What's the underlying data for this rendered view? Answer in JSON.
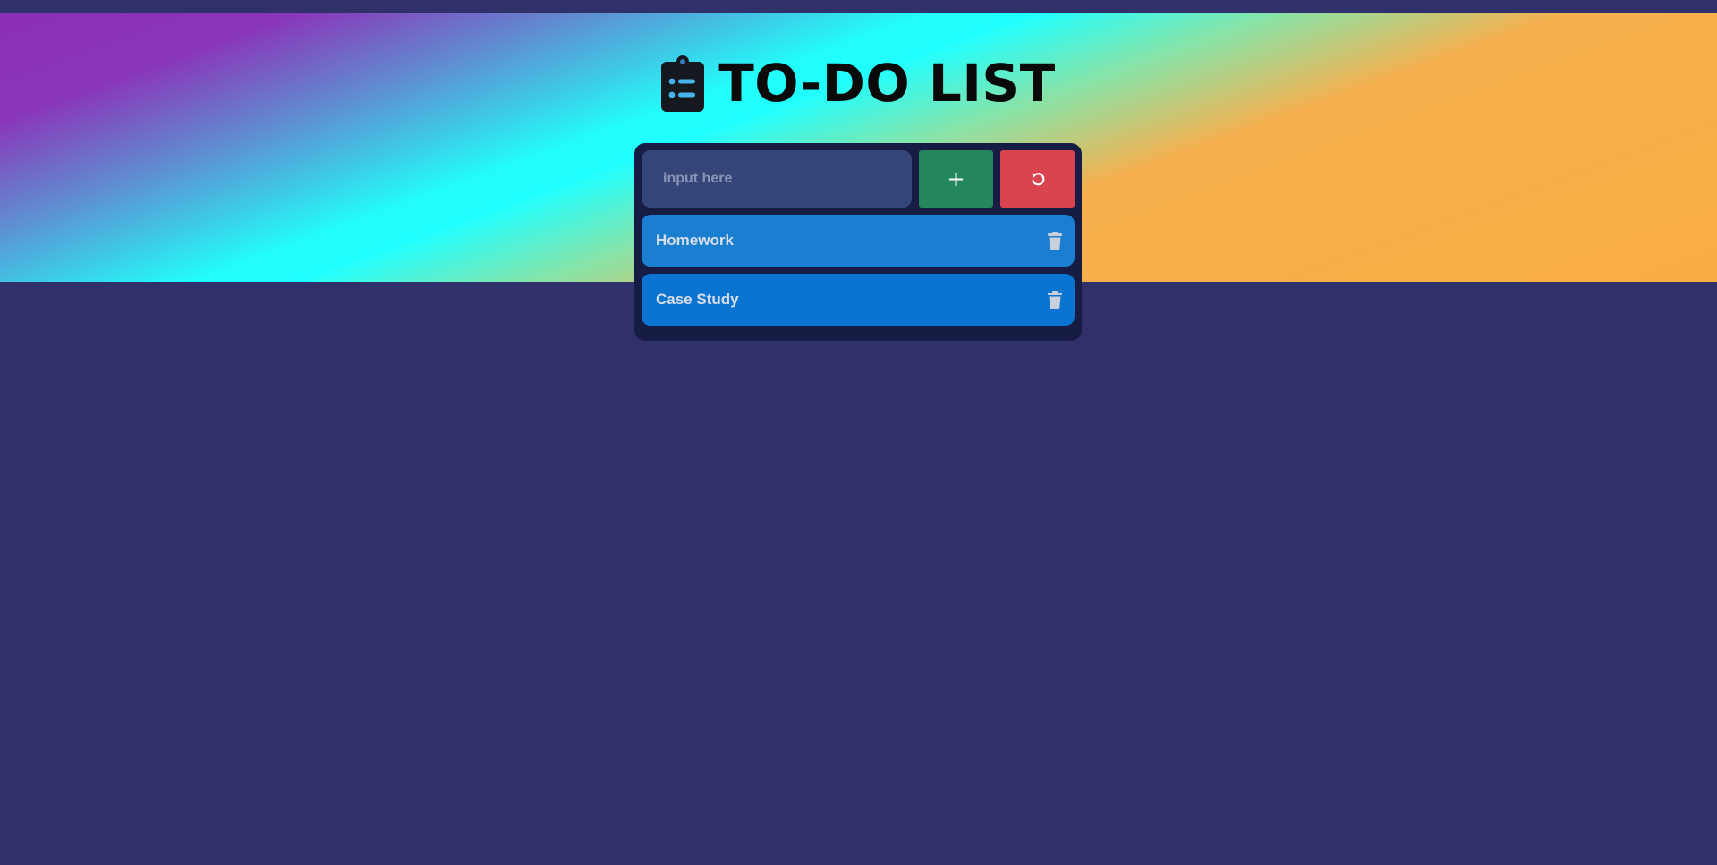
{
  "header": {
    "title": "TO-DO LIST",
    "icon": "clipboard-list-icon"
  },
  "input": {
    "placeholder": "input here",
    "value": ""
  },
  "buttons": {
    "add": {
      "label": "+",
      "icon": "plus-icon",
      "color": "#24875c"
    },
    "reset": {
      "icon": "rotate-left-icon",
      "color": "#d9444e"
    }
  },
  "todos": [
    {
      "label": "Homework",
      "icon": "trash-icon"
    },
    {
      "label": "Case Study",
      "icon": "trash-icon"
    }
  ],
  "colors": {
    "background": "#30316b",
    "card": "#171c45",
    "input_bg": "#34457a",
    "todo_item": "#1a7fd0",
    "gradient": [
      "#8b2fb6",
      "#20ffff",
      "#fbad43"
    ]
  }
}
